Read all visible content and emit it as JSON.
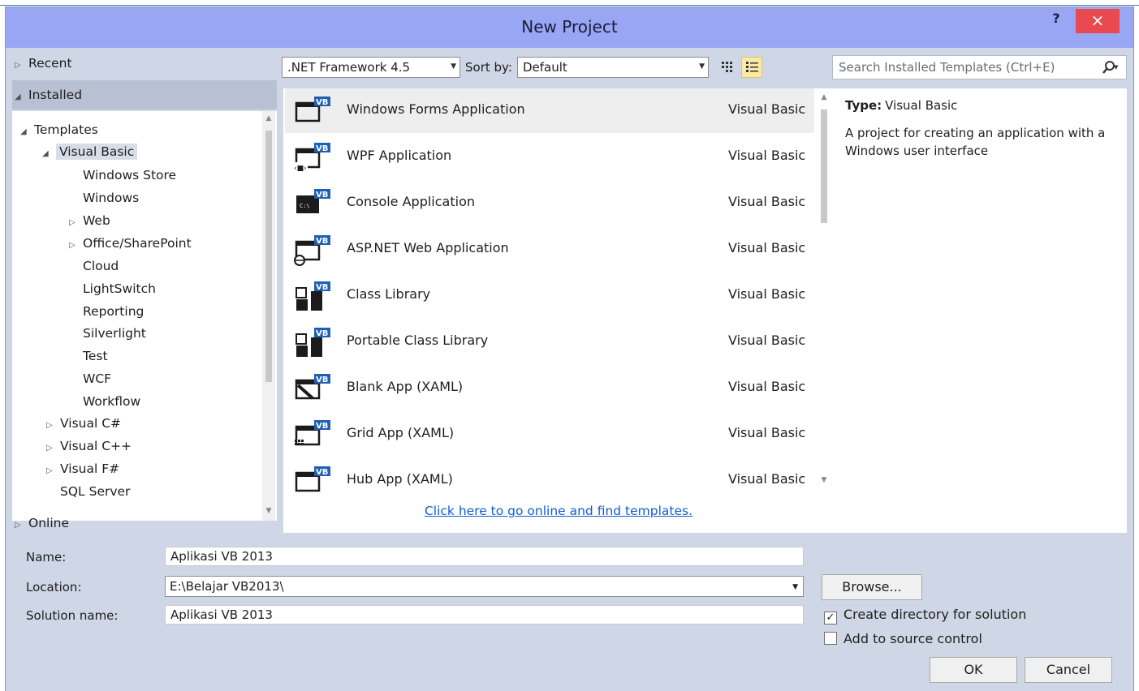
{
  "window": {
    "title": "New Project",
    "help": "?",
    "close": "×"
  },
  "sidebar": {
    "recent": "Recent",
    "installed": "Installed",
    "online": "Online",
    "tree": {
      "templates": "Templates",
      "visual_basic": "Visual Basic",
      "vb_children": [
        "Windows Store",
        "Windows",
        "Web",
        "Office/SharePoint",
        "Cloud",
        "LightSwitch",
        "Reporting",
        "Silverlight",
        "Test",
        "WCF",
        "Workflow"
      ],
      "visual_csharp": "Visual C#",
      "visual_cpp": "Visual C++",
      "visual_fsharp": "Visual F#",
      "sql_server": "SQL Server"
    }
  },
  "toolbar": {
    "framework": ".NET Framework 4.5",
    "sort_label": "Sort by:",
    "sort_value": "Default"
  },
  "search": {
    "placeholder": "Search Installed Templates (Ctrl+E)"
  },
  "templates": [
    {
      "name": "Windows Forms Application",
      "lang": "Visual Basic",
      "icon": "winforms-vb-icon"
    },
    {
      "name": "WPF Application",
      "lang": "Visual Basic",
      "icon": "wpf-vb-icon"
    },
    {
      "name": "Console Application",
      "lang": "Visual Basic",
      "icon": "console-vb-icon"
    },
    {
      "name": "ASP.NET Web Application",
      "lang": "Visual Basic",
      "icon": "aspnet-vb-icon"
    },
    {
      "name": "Class Library",
      "lang": "Visual Basic",
      "icon": "class-library-vb-icon"
    },
    {
      "name": "Portable Class Library",
      "lang": "Visual Basic",
      "icon": "portable-class-library-vb-icon"
    },
    {
      "name": "Blank App (XAML)",
      "lang": "Visual Basic",
      "icon": "blank-app-vb-icon"
    },
    {
      "name": "Grid App (XAML)",
      "lang": "Visual Basic",
      "icon": "grid-app-vb-icon"
    },
    {
      "name": "Hub App (XAML)",
      "lang": "Visual Basic",
      "icon": "hub-app-vb-icon"
    }
  ],
  "online_link": "Click here to go online and find templates.",
  "info": {
    "type_label": "Type:",
    "type_value": "Visual Basic",
    "description": "A project for creating an application with a Windows user interface"
  },
  "form": {
    "name_label": "Name:",
    "name_value": "Aplikasi VB 2013",
    "location_label": "Location:",
    "location_value": "E:\\Belajar VB2013\\",
    "solution_label": "Solution name:",
    "solution_value": "Aplikasi VB 2013",
    "browse": "Browse...",
    "create_dir": "Create directory for solution",
    "create_dir_checked": true,
    "source_control": "Add to source control",
    "source_control_checked": false,
    "ok": "OK",
    "cancel": "Cancel"
  },
  "colors": {
    "title_bar": "#98a6f4",
    "close": "#e84a4f",
    "link": "#0e5fd0",
    "vb_badge": "#1f5fb4"
  }
}
